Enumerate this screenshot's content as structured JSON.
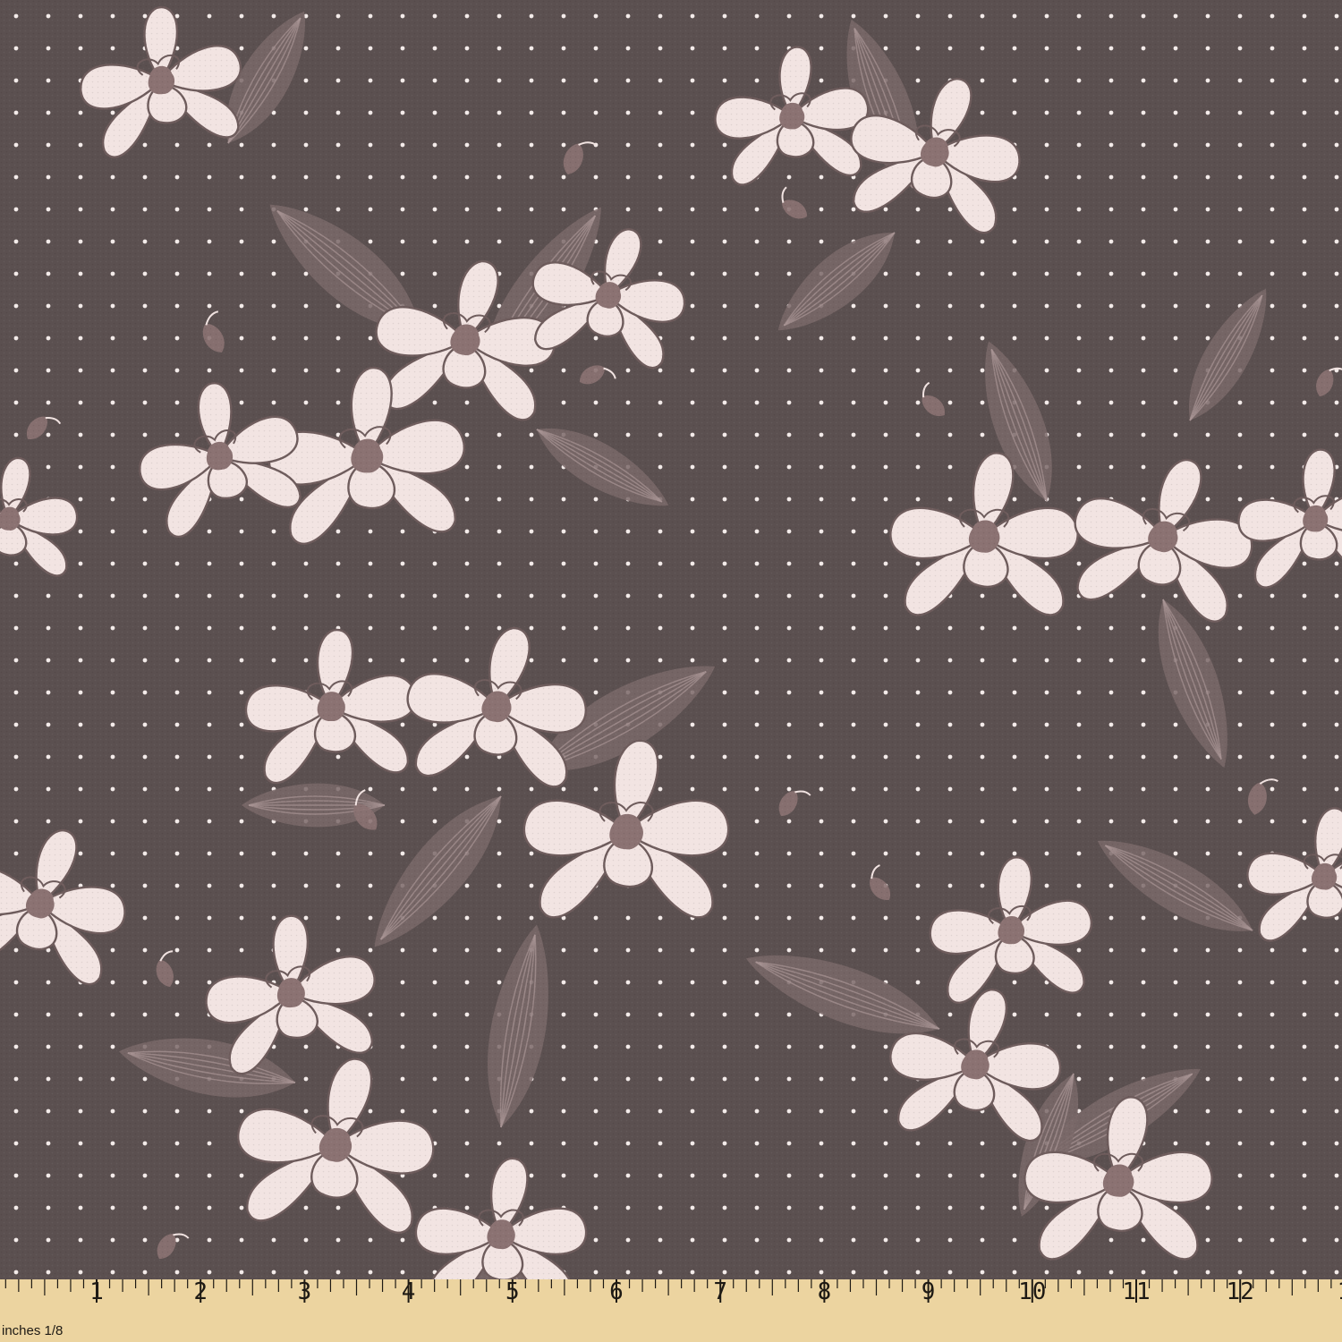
{
  "colors": {
    "fabric_background": "#5b5050",
    "dot": "#f4ecea",
    "petal": "#f2e4e2",
    "petal_outline": "#6e5c5c",
    "flower_center": "#8b7272",
    "leaf": "#7a6868",
    "leaf_vein": "#a89494",
    "ruler_wood": "#ecd4a0",
    "ruler_ink": "#1e1a14"
  },
  "fabric": {
    "pattern": "orchid-flowers-on-polka-dots",
    "dot_spacing_note": "regular polka dot grid"
  },
  "ruler": {
    "unit_label": "inches 1/8",
    "numbers": [
      "1",
      "2",
      "3",
      "4",
      "5",
      "6",
      "7",
      "8",
      "9",
      "10",
      "11",
      "12",
      "1"
    ]
  }
}
